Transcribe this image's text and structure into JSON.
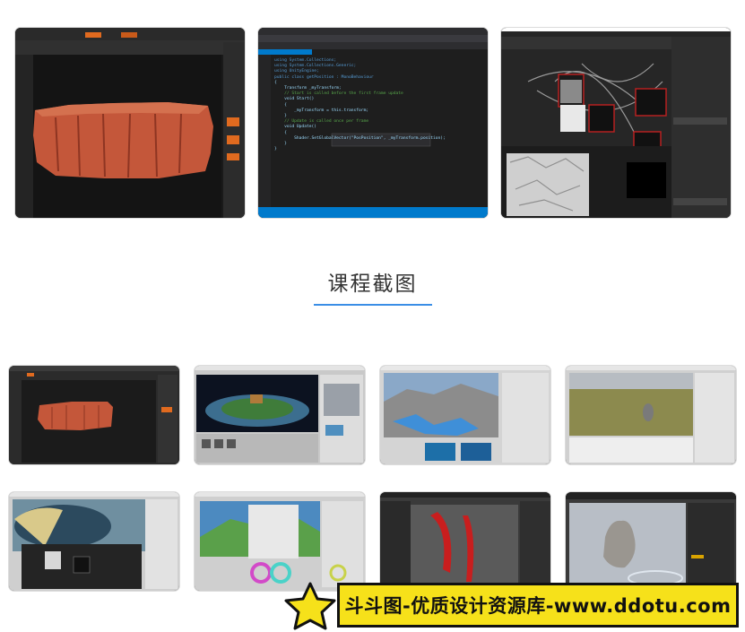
{
  "section": {
    "title": "课程截图"
  },
  "top_row": [
    {
      "name": "zbrush-rock-sculpt"
    },
    {
      "name": "visual-studio-code"
    },
    {
      "name": "substance-node-graph"
    }
  ],
  "code_panel": {
    "lines": [
      "using System.Collections;",
      "using System.Collections.Generic;",
      "using UnityEngine;",
      "",
      "public class getPosition : MonoBehaviour",
      "{",
      "    Transform _myTransform;",
      "    // Start is called before the first frame update",
      "    void Start()",
      "    {",
      "        _myTransform = this.transform;",
      "    }",
      "",
      "    // Update is called once per frame",
      "    void Update()",
      "    {",
      "        Shader.SetGlobalVector(\"PosPosition\", _myTransform.position);",
      "    }",
      "}"
    ]
  },
  "grid": [
    {
      "name": "zbrush-rock"
    },
    {
      "name": "unity-scene-island"
    },
    {
      "name": "terrain-blockout"
    },
    {
      "name": "grass-terrain"
    },
    {
      "name": "material-nodes"
    },
    {
      "name": "color-grading"
    },
    {
      "name": "red-curve-panel"
    },
    {
      "name": "stone-statue"
    }
  ],
  "watermark": {
    "text": "斗斗图-优质设计资源库-www.ddotu.com"
  },
  "colors": {
    "accent": "#3a8ee6",
    "watermark_bg": "#f6e11a",
    "rock": "#c4573a"
  }
}
